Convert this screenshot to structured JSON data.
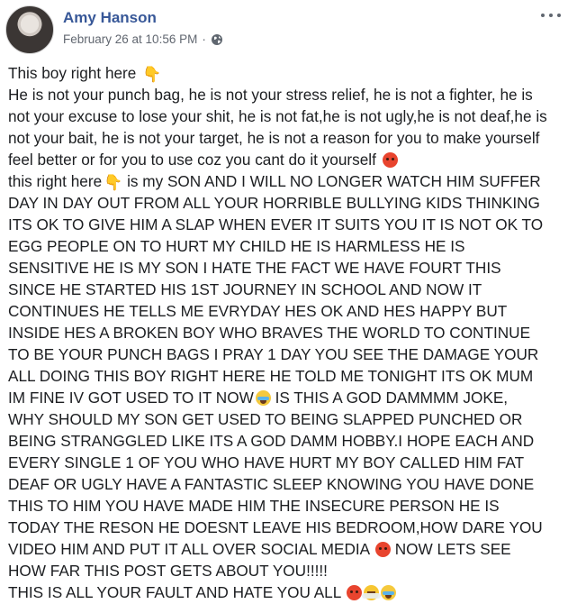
{
  "post": {
    "author": "Amy Hanson",
    "timestamp": "February 26 at 10:56 PM",
    "separator": "·",
    "privacy_icon": "globe-icon",
    "more_icon": "more-options-icon"
  },
  "lines": [
    "This boy right here",
    "He is not your punch bag, he is not your stress relief, he is not a fighter, he is",
    "not your excuse to lose your shit, he is not fat,he is not ugly,he is not deaf,he is",
    "not your bait, he is not your target, he is not a reason for you to make yourself",
    "feel better or for you to use coz you cant do it yourself",
    "this right here",
    "is my SON AND I WILL NO LONGER WATCH HIM SUFFER",
    "DAY IN DAY OUT FROM ALL YOUR HORRIBLE BULLYING KIDS THINKING",
    "ITS OK TO GIVE HIM A SLAP WHEN EVER IT SUITS YOU IT IS NOT OK TO",
    "EGG PEOPLE ON TO HURT MY CHILD HE IS HARMLESS HE IS",
    "SENSITIVE HE IS MY SON I HATE THE FACT WE HAVE FOURT THIS",
    "SINCE HE STARTED HIS 1ST JOURNEY IN SCHOOL AND NOW IT",
    "CONTINUES HE TELLS ME EVRYDAY HES OK AND HES HAPPY BUT",
    "INSIDE HES A BROKEN BOY WHO BRAVES THE WORLD TO CONTINUE",
    "TO BE YOUR PUNCH BAGS I PRAY 1 DAY YOU SEE THE DAMAGE YOUR",
    "ALL DOING THIS BOY RIGHT HERE HE TOLD ME TONIGHT ITS OK MUM",
    "IM FINE IV GOT USED TO IT NOW",
    "IS THIS A GOD DAMMMM JOKE,",
    "WHY SHOULD MY SON GET USED TO BEING SLAPPED PUNCHED OR",
    "BEING STRANGGLED LIKE ITS A GOD DAMM HOBBY.I HOPE EACH AND",
    "EVERY SINGLE 1 OF YOU WHO HAVE HURT MY BOY CALLED HIM FAT",
    "DEAF OR UGLY HAVE A FANTASTIC SLEEP KNOWING YOU HAVE DONE",
    "THIS TO HIM YOU HAVE MADE HIM THE INSECURE PERSON HE IS",
    "TODAY THE RESON HE DOESNT LEAVE HIS BEDROOM,HOW DARE YOU",
    "VIDEO HIM AND PUT IT ALL OVER SOCIAL MEDIA",
    "NOW LETS SEE",
    "HOW FAR THIS POST GETS ABOUT YOU!!!!!",
    "THIS IS ALL YOUR FAULT AND HATE YOU ALL"
  ],
  "emoji": {
    "pointing_down": "👇",
    "angry_face": "angry-face-icon",
    "crying_face": "crying-face-icon",
    "steam_face": "steam-face-icon"
  }
}
